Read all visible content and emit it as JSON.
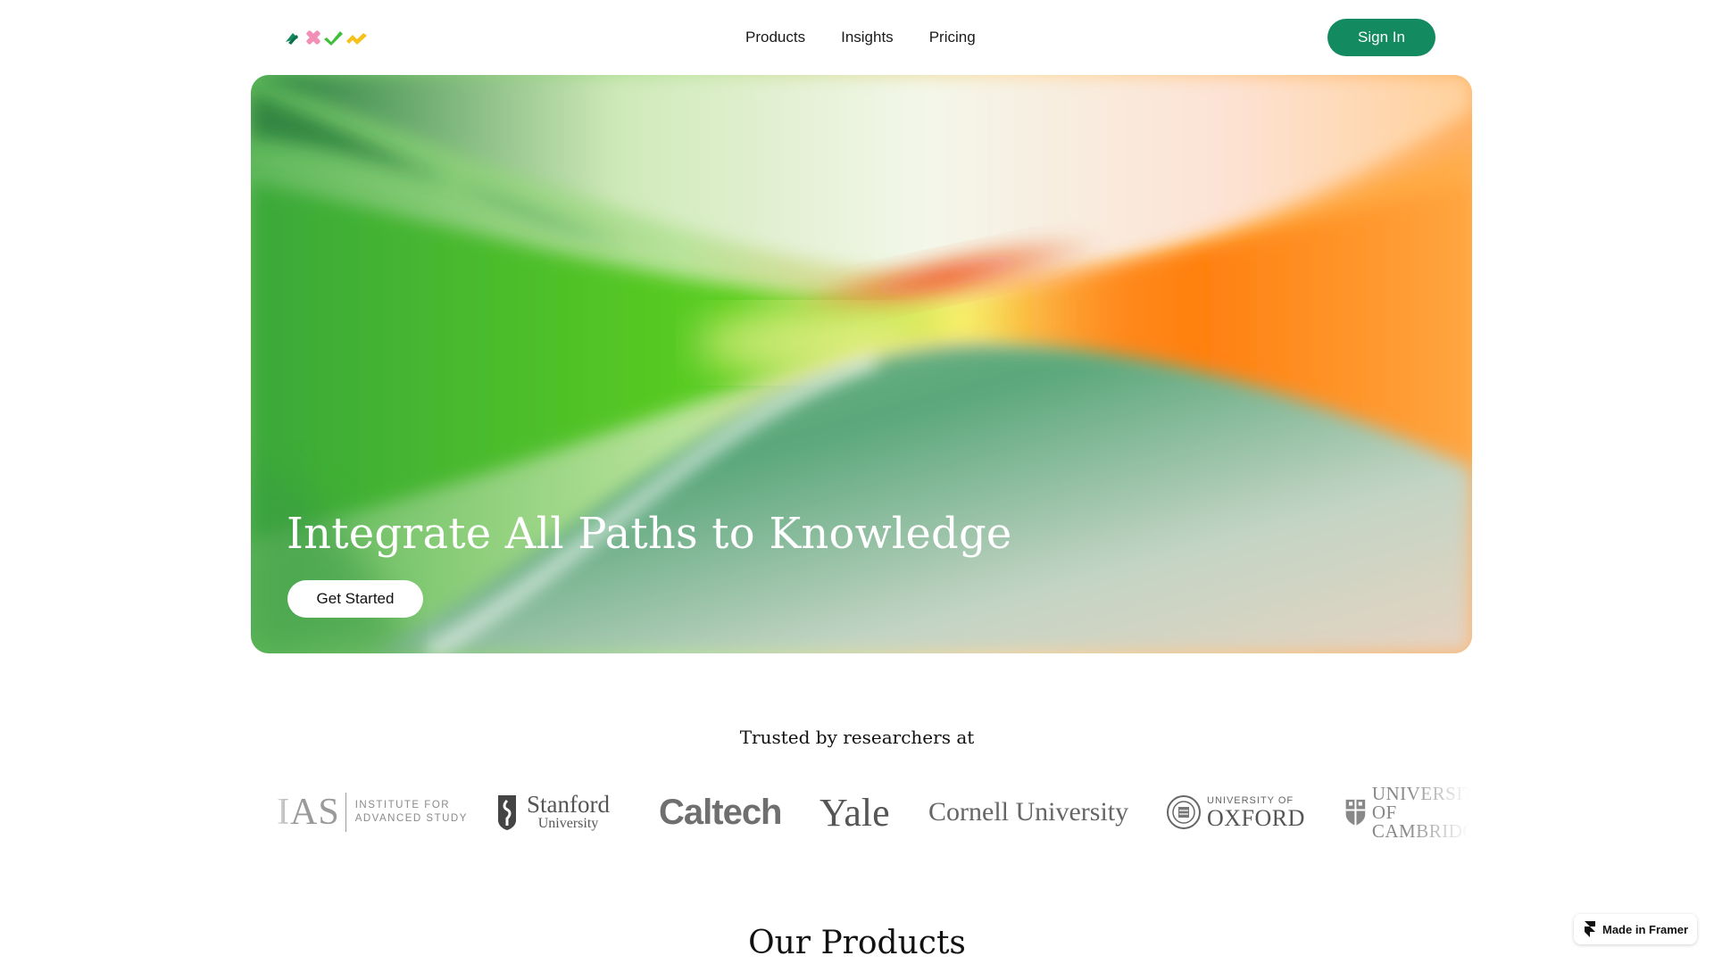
{
  "brand": {
    "logo_name": "axym logo",
    "colors": {
      "green": "#138a5f",
      "pink": "#f28fb6",
      "lime": "#3fbf3a",
      "yellow": "#f5c21b"
    }
  },
  "nav": {
    "links": [
      "Products",
      "Insights",
      "Pricing"
    ],
    "signin_label": "Sign In"
  },
  "hero": {
    "title": "Integrate All Paths to Knowledge",
    "cta_label": "Get Started"
  },
  "trusted": {
    "heading": "Trusted by researchers at",
    "logos": {
      "ias_big": "IAS",
      "ias_line1": "INSTITUTE FOR",
      "ias_line2": "ADVANCED STUDY",
      "stanford_name": "Stanford",
      "stanford_sub": "University",
      "caltech": "Caltech",
      "yale": "Yale",
      "cornell": "Cornell University",
      "oxford_small": "UNIVERSITY OF",
      "oxford_big": "OXFORD",
      "cambridge_line1": "UNIVERSITY OF",
      "cambridge_line2": "CAMBRIDGE"
    }
  },
  "products": {
    "heading": "Our Products"
  },
  "badge": {
    "label": "Made in Framer",
    "icon": "framer-icon"
  }
}
